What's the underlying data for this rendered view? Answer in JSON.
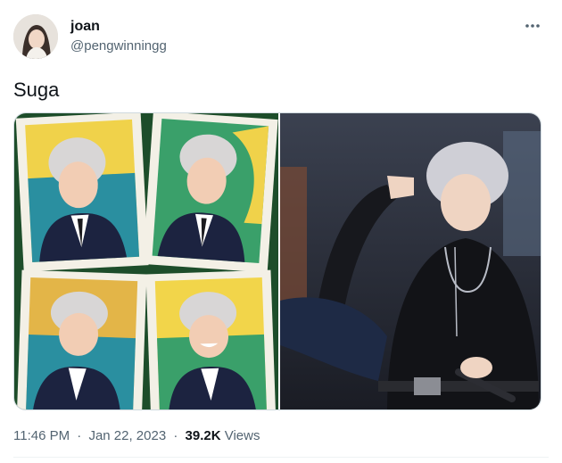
{
  "author": {
    "display_name": "joan",
    "handle": "@pengwinningg"
  },
  "tweet": {
    "text": "Suga"
  },
  "meta": {
    "time": "11:46 PM",
    "separator": "·",
    "date": "Jan 22, 2023",
    "views_count": "39.2K",
    "views_label": "Views"
  },
  "icons": {
    "more": "more-horizontal-icon"
  },
  "colors": {
    "secondary_text": "#536471",
    "primary_text": "#0f1419",
    "border": "#cfd9de"
  }
}
